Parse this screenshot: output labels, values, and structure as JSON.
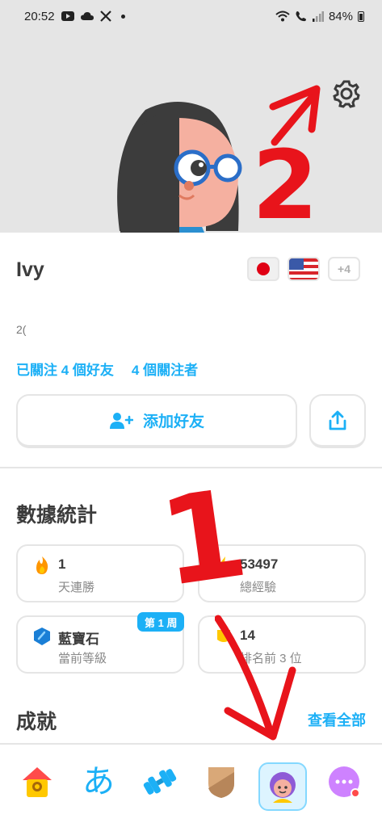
{
  "status": {
    "time": "20:52",
    "battery": "84%"
  },
  "profile": {
    "name": "Ivy",
    "joined_fragment": "2(",
    "following": "已關注 4 個好友",
    "followers": "4 個關注者",
    "flags_more": "+4",
    "add_friend_label": "添加好友"
  },
  "stats": {
    "title": "數據統計",
    "cards": [
      {
        "value": "1",
        "label": "天連勝",
        "icon": "flame-icon"
      },
      {
        "value": "53497",
        "label": "總經驗",
        "icon": "lightning-icon"
      },
      {
        "value": "藍寶石",
        "label": "當前等級",
        "icon": "sapphire-league-icon"
      },
      {
        "value": "14",
        "label": "排名前 3 位",
        "icon": "medal-icon"
      }
    ],
    "week_badge": "第 1 周"
  },
  "achievements": {
    "title": "成就",
    "see_all": "查看全部"
  },
  "annotations": {
    "marker_1": "1",
    "marker_2": "2"
  },
  "tabs": [
    {
      "name": "home",
      "icon": "home-icon"
    },
    {
      "name": "characters",
      "icon": "hiragana-icon",
      "glyph": "あ"
    },
    {
      "name": "practice",
      "icon": "dumbbell-icon"
    },
    {
      "name": "leagues",
      "icon": "shield-icon"
    },
    {
      "name": "profile",
      "icon": "avatar-icon"
    },
    {
      "name": "more",
      "icon": "more-icon"
    }
  ],
  "colors": {
    "accent": "#1cb0f6",
    "annotation": "#e8141b",
    "hero_bg": "#e5e5e5"
  }
}
